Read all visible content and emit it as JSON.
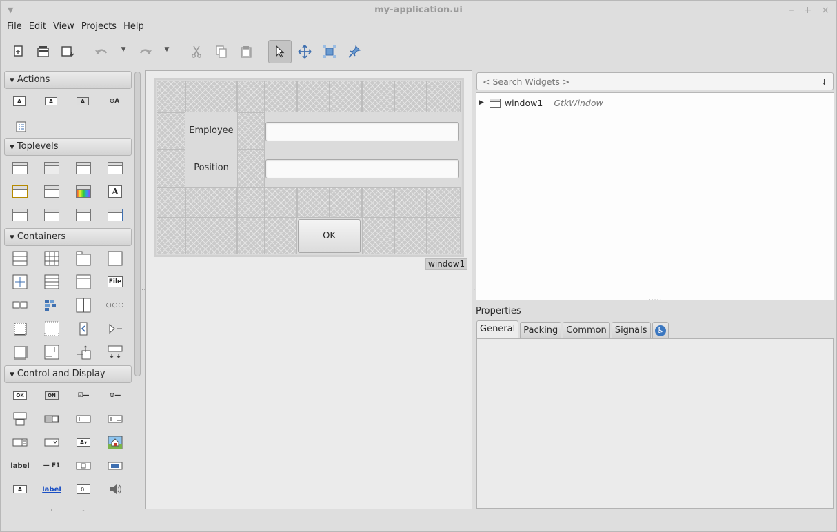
{
  "window": {
    "title": "my-application.ui"
  },
  "window_controls": {
    "minimize": "–",
    "maximize": "+",
    "close": "×"
  },
  "menu": [
    "File",
    "Edit",
    "View",
    "Projects",
    "Help"
  ],
  "toolbar": {
    "icons": [
      "new-file-icon",
      "open-file-icon",
      "save-file-icon",
      "undo-icon",
      "redo-icon",
      "cut-icon",
      "copy-icon",
      "paste-icon",
      "pointer-icon",
      "drag-resize-icon",
      "margin-edit-icon",
      "align-edit-icon"
    ],
    "active": "pointer-icon"
  },
  "palette": {
    "sections": [
      {
        "label": "Actions"
      },
      {
        "label": "Toplevels"
      },
      {
        "label": "Containers"
      },
      {
        "label": "Control and Display"
      }
    ],
    "icon_texts": {
      "file": "File",
      "ok": "OK",
      "on": "ON",
      "label": "label",
      "f1": "— F1",
      "link": "label",
      "spin": "0.",
      "a": "A"
    }
  },
  "form": {
    "employee_label": "Employee",
    "position_label": "Position",
    "employee_value": "",
    "position_value": "",
    "ok_label": "OK",
    "window_tag": "window1"
  },
  "search": {
    "placeholder": "< Search Widgets >"
  },
  "tree": {
    "name": "window1",
    "type": "GtkWindow"
  },
  "properties": {
    "title": "Properties",
    "tabs": [
      "General",
      "Packing",
      "Common",
      "Signals"
    ],
    "active_tab": "General"
  },
  "colors": {
    "accessibility": "#3b77c0"
  }
}
